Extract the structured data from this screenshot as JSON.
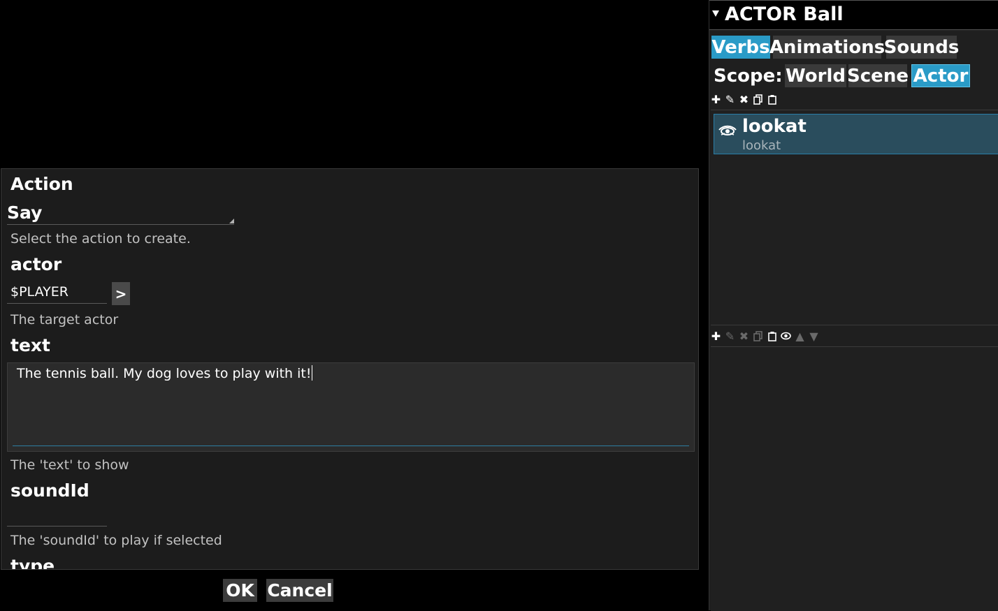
{
  "dialog": {
    "action_title": "Action",
    "action_value": "Say",
    "action_desc": "Select the action to create.",
    "actor_title": "actor",
    "actor_value": "$PLAYER",
    "actor_button": ">",
    "actor_desc": "The target actor",
    "text_title": "text",
    "text_value": "The tennis ball. My dog loves to play with it!",
    "text_desc": "The 'text' to show",
    "sound_title": "soundId",
    "sound_value": "",
    "sound_desc": "The 'soundId' to play if selected",
    "type_title": "type",
    "ok_label": "OK",
    "cancel_label": "Cancel"
  },
  "panel": {
    "title": "ACTOR Ball",
    "tabs": [
      "Verbs",
      "Animations",
      "Sounds"
    ],
    "active_tab": "Verbs",
    "scope_label": "Scope:",
    "scopes": [
      "World",
      "Scene",
      "Actor"
    ],
    "active_scope": "Actor",
    "verb_list": [
      {
        "title": "lookat",
        "subtitle": "lookat",
        "icon": "eye-icon"
      }
    ],
    "toolbar1_icons": [
      "add-icon",
      "edit-icon",
      "delete-icon",
      "copy-icon",
      "paste-icon"
    ],
    "toolbar2_icons": [
      "add-icon",
      "edit-icon",
      "delete-icon",
      "copy-icon",
      "paste-icon",
      "eye-icon",
      "up-icon",
      "down-icon"
    ],
    "accent_color": "#2a9bc7"
  }
}
